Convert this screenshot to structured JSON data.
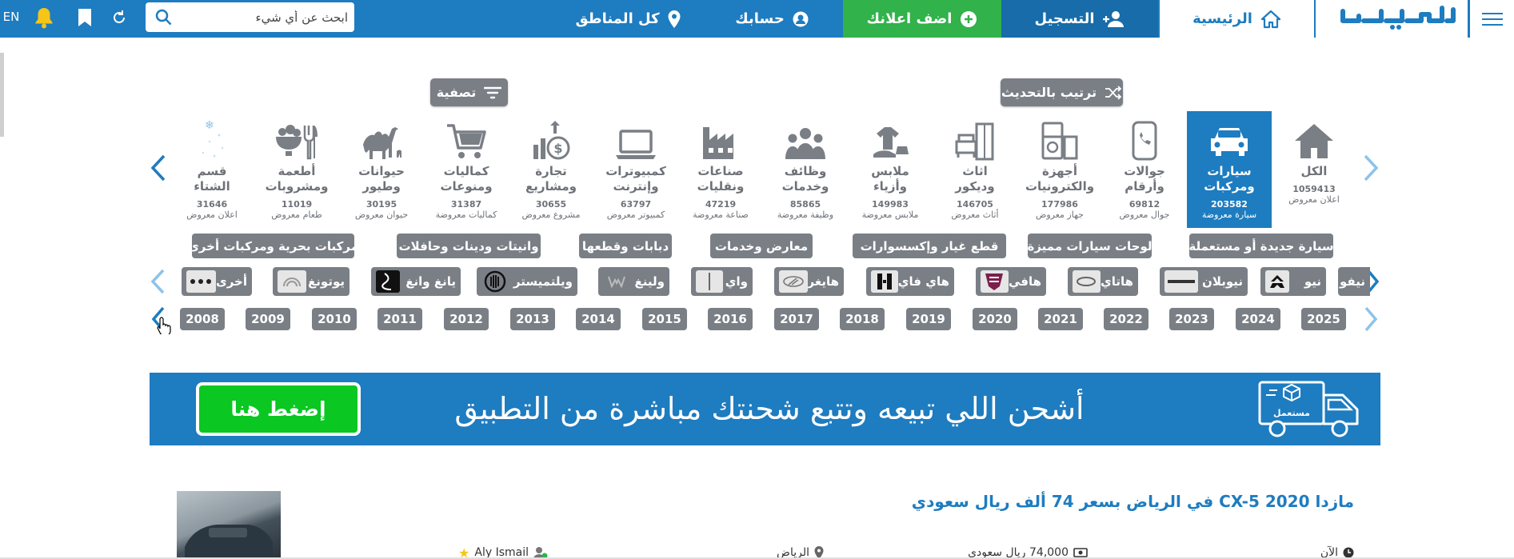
{
  "topbar": {
    "lang": "EN",
    "search_placeholder": "ابحث عن أي شيء",
    "regions": "كل المناطق",
    "account": "حسابك",
    "add_ad": "اضف اعلانك",
    "register": "التسجيل",
    "home": "الرئيسية",
    "logo": "مستعمل",
    "brand_color": "#1e7cc0",
    "add_color": "#31b24a"
  },
  "toolbar": {
    "filter": "تصفية",
    "sort": "ترتيب بالتحديث"
  },
  "categories": [
    {
      "name": "الكل",
      "count": "1059413",
      "unit": "اعلان معروض",
      "icon": "home-icon"
    },
    {
      "name": "سيارات\nومركبات",
      "count": "203582",
      "unit": "سيارة معروضة",
      "icon": "car-icon"
    },
    {
      "name": "جوالات\nوأرقام",
      "count": "69812",
      "unit": "جوال معروض",
      "icon": "phone-icon"
    },
    {
      "name": "أجهزة\nوالكترونيات",
      "count": "177986",
      "unit": "جهاز معروض",
      "icon": "fridge-icon"
    },
    {
      "name": "اثاث\nوديكور",
      "count": "146705",
      "unit": "أثاث معروض",
      "icon": "furniture-icon"
    },
    {
      "name": "ملابس\nوأزياء",
      "count": "149983",
      "unit": "ملابس معروضة",
      "icon": "clothes-icon"
    },
    {
      "name": "وظائف\nوخدمات",
      "count": "85865",
      "unit": "وظيفة معروضة",
      "icon": "people-icon"
    },
    {
      "name": "صناعات\nونقليات",
      "count": "47219",
      "unit": "صناعة معروضة",
      "icon": "factory-icon"
    },
    {
      "name": "كمبيوترات\nوإنترنت",
      "count": "63797",
      "unit": "كمبيوتر معروض",
      "icon": "laptop-icon"
    },
    {
      "name": "تجارة\nومشاريع",
      "count": "30655",
      "unit": "مشروع معروض",
      "icon": "business-icon"
    },
    {
      "name": "كماليات\nومنوعات",
      "count": "31387",
      "unit": "كماليات معروضة",
      "icon": "cart-icon"
    },
    {
      "name": "حيوانات\nوطيور",
      "count": "30195",
      "unit": "حيوان معروض",
      "icon": "camel-icon"
    },
    {
      "name": "أطعمة\nومشروبات",
      "count": "11019",
      "unit": "طعام معروض",
      "icon": "food-icon"
    },
    {
      "name": "قسم\nالشتاء",
      "count": "31646",
      "unit": "اعلان معروض",
      "icon": "snow-icon"
    }
  ],
  "subcategories": [
    "سيارة جديدة أو مستعملة",
    "لوحات سيارات مميزة",
    "قطع غيار وإكسسوارات",
    "معارض وخدمات",
    "دبابات وقطعها",
    "وانيتات ودينات وحافلات",
    "مركبات بحرية ومركبات أخرى"
  ],
  "brands": [
    "نيفو",
    "نيو",
    "نيوبلان",
    "هاتاي",
    "هافي",
    "هاي فاي",
    "هايغر",
    "واي",
    "ولينغ",
    "ويلتميستر",
    "يانغ وانغ",
    "يوتونغ",
    "أخرى"
  ],
  "years": [
    "2025",
    "2024",
    "2023",
    "2022",
    "2021",
    "2020",
    "2019",
    "2018",
    "2017",
    "2016",
    "2015",
    "2014",
    "2013",
    "2012",
    "2011",
    "2010",
    "2009",
    "2008"
  ],
  "banner": {
    "text": "أشحن اللي تبيعه وتتبع شحنتك مباشرة من التطبيق",
    "button": "إضغط هنا",
    "van_label": "مستعمل"
  },
  "listing": {
    "title": "مازدا 2020 CX-5 في الرياض بسعر 74 ألف ريال سعودي",
    "time": "الآن",
    "price": "74,000 ريال سعودي",
    "city": "الرياض",
    "user": "Aly Ismail"
  }
}
